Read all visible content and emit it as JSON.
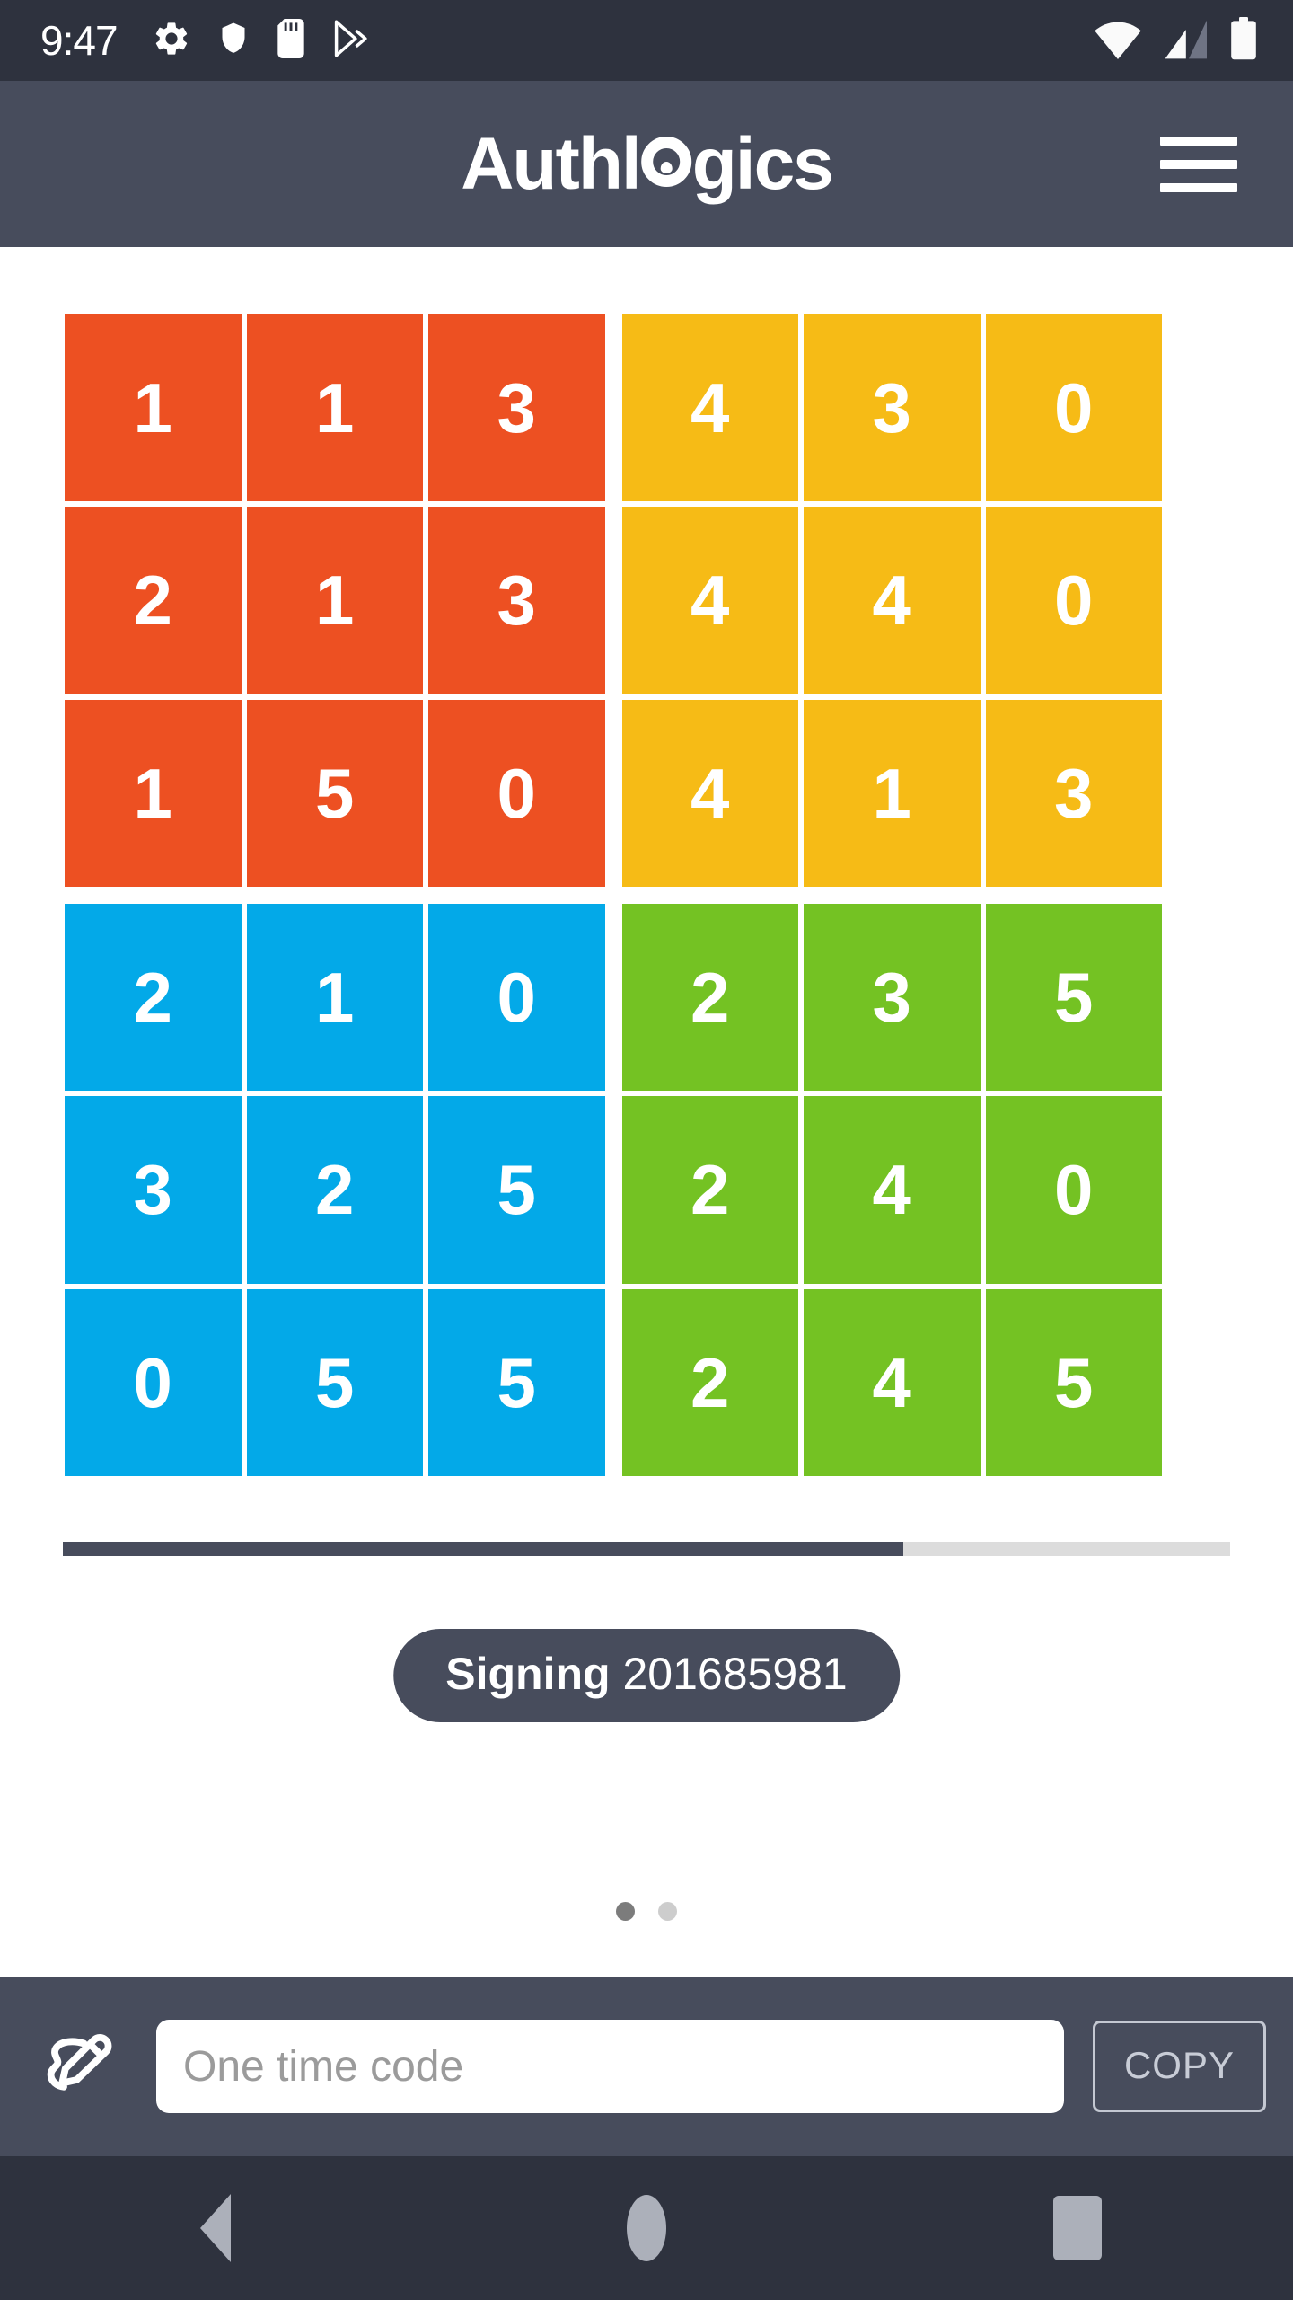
{
  "status_bar": {
    "clock": "9:47",
    "left_icons": [
      "gear-icon",
      "shield-icon",
      "sd-card-icon",
      "play-store-icon"
    ],
    "right_icons": [
      "wifi-icon",
      "cellular-signal-icon",
      "battery-icon"
    ],
    "background": "#2e323e"
  },
  "app_bar": {
    "title": "Auth",
    "title_part1": "Auth",
    "title_part2": "l",
    "title_part3": "gics",
    "logo_full": "Authlogics",
    "menu_label": "menu",
    "background": "#474c5c"
  },
  "grid": {
    "colors": {
      "orange": "#ed5022",
      "yellow": "#f6bb16",
      "blue": "#03a9e8",
      "green": "#74c223"
    },
    "quadrants": [
      {
        "name": "orange",
        "color": "#ed5022",
        "rows": [
          [
            1,
            1,
            3
          ],
          [
            2,
            1,
            3
          ],
          [
            1,
            5,
            0
          ]
        ]
      },
      {
        "name": "yellow",
        "color": "#f6bb16",
        "rows": [
          [
            4,
            3,
            0
          ],
          [
            4,
            4,
            0
          ],
          [
            4,
            1,
            3
          ]
        ]
      },
      {
        "name": "blue",
        "color": "#03a9e8",
        "rows": [
          [
            2,
            1,
            0
          ],
          [
            3,
            2,
            5
          ],
          [
            0,
            5,
            5
          ]
        ]
      },
      {
        "name": "green",
        "color": "#74c223",
        "rows": [
          [
            2,
            3,
            5
          ],
          [
            2,
            4,
            0
          ],
          [
            2,
            4,
            5
          ]
        ]
      }
    ]
  },
  "progress": {
    "percent": 72,
    "fill_color": "#474c5c",
    "track_color": "#dcdcdc"
  },
  "signing_pill": {
    "label": "Signing",
    "code": "201685981",
    "background": "#474c5c"
  },
  "page_dots": {
    "count": 2,
    "active_index": 0,
    "active_color": "#7c7c7c",
    "inactive_color": "#cdcdcd"
  },
  "bottom_bar": {
    "pen_icon": "signature-pen-icon",
    "otp_placeholder": "One time code",
    "otp_value": "",
    "copy_label": "COPY",
    "background": "#474c5c"
  },
  "nav_bar": {
    "back_label": "Back",
    "home_label": "Home",
    "recents_label": "Recents",
    "background": "#2e323e",
    "icon_color": "#acb0ba"
  }
}
